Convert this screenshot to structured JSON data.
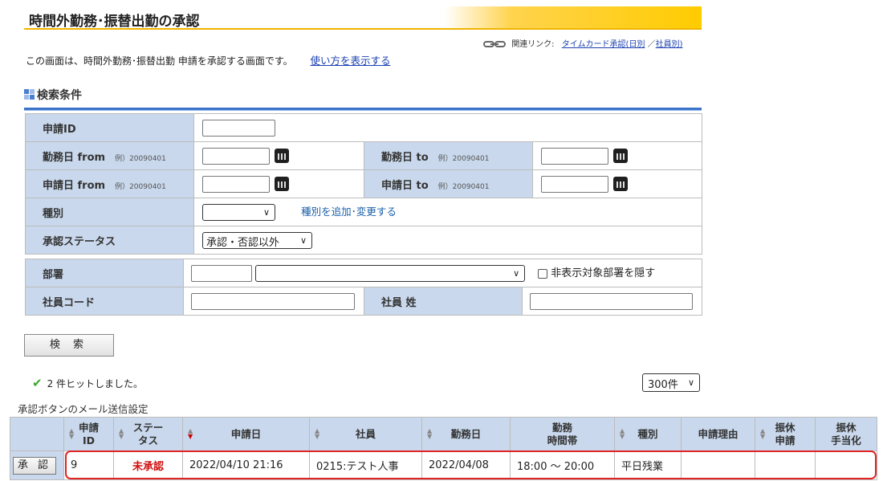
{
  "page": {
    "title": "時間外勤務･振替出勤の承認",
    "related_label": "関連リンク:",
    "related_link1": "タイムカード承認(日別",
    "related_sep": "／",
    "related_link2": "社員別)",
    "intro_text": "この画面は、時間外勤務･振替出勤 申請を承認する画面です。",
    "help_link": "使い方を表示する"
  },
  "search": {
    "section_title": "検索条件",
    "apply_id_label": "申請ID",
    "work_from_label": "勤務日 from",
    "work_to_label": "勤務日 to",
    "apply_from_label": "申請日 from",
    "apply_to_label": "申請日 to",
    "example": "例）20090401",
    "type_label": "種別",
    "type_link": "種別を追加･変更する",
    "status_label": "承認ステータス",
    "status_value": "承認・否認以外",
    "dept_label": "部署",
    "hide_dept_label": "非表示対象部署を隠す",
    "emp_code_label": "社員コード",
    "emp_name_label": "社員 姓",
    "search_button": "検 索"
  },
  "results": {
    "hits": "2 件ヒットしました。",
    "per_page": "300件",
    "mail_setting": "承認ボタンのメール送信設定",
    "headers": {
      "id": "申請\nID",
      "status": "ステー\nタス",
      "apply_date": "申請日",
      "employee": "社員",
      "work_date": "勤務日",
      "time": "勤務\n時間帯",
      "type": "種別",
      "reason": "申請理由",
      "comp_apply": "振休\n申請",
      "comp_allow": "振休\n手当化"
    },
    "row": {
      "approve_button": "承 認",
      "id": "9",
      "status": "未承認",
      "apply_date": "2022/04/10 21:16",
      "employee": "0215:テスト人事",
      "work_date": "2022/04/08",
      "time": "18:00 ～ 20:00",
      "type": "平日残業",
      "reason": "",
      "comp_apply": "",
      "comp_allow": ""
    }
  },
  "colors": {
    "label_bg": "#c9d8ec",
    "accent_blue": "#3a73c8",
    "title_yellow": "#ffcc00",
    "status_red": "#d01010",
    "highlight_red": "#e02424"
  }
}
